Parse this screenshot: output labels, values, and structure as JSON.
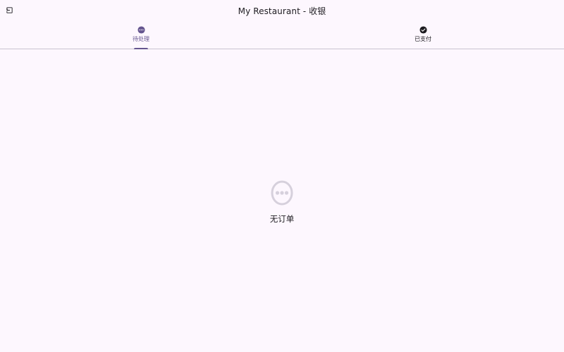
{
  "app": {
    "title": "My Restaurant - 收银",
    "accent_color": "#65558f",
    "background_color": "#fdf7fe"
  },
  "topbar": {
    "back_icon": "exit-to-app-icon"
  },
  "tabs": [
    {
      "label": "待处理",
      "icon": "more-horiz-circle-icon",
      "active": true
    },
    {
      "label": "已支付",
      "icon": "check-circle-icon",
      "active": false
    }
  ],
  "empty_state": {
    "icon": "more-horiz-circle-outline-icon",
    "text": "无订单"
  }
}
